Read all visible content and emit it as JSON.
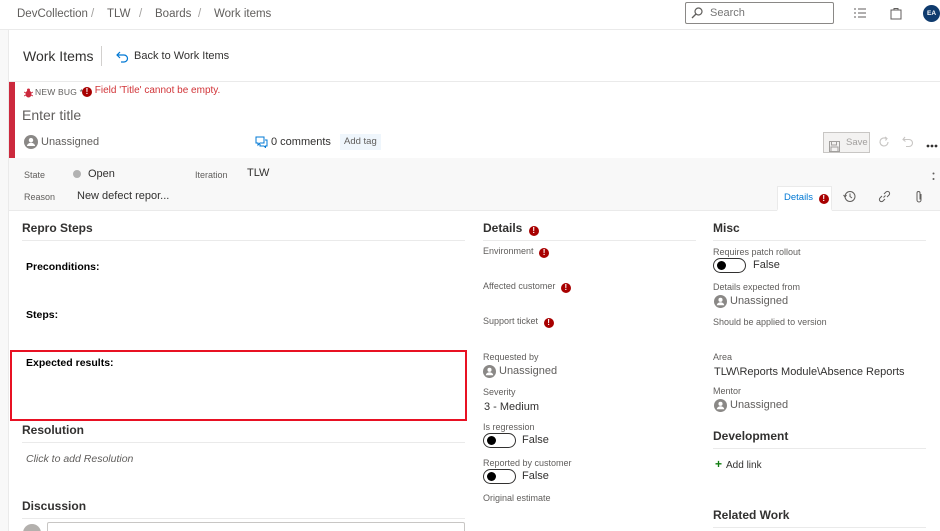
{
  "breadcrumb": {
    "org": "DevCollection",
    "project": "TLW",
    "hub": "Boards",
    "page": "Work items",
    "separator": "/"
  },
  "search": {
    "placeholder": "Search"
  },
  "user": {
    "initials": "EA"
  },
  "header": {
    "title": "Work Items",
    "back_label": "Back to Work Items"
  },
  "work_item": {
    "type_label": "NEW BUG *",
    "title_error": "Field 'Title' cannot be empty.",
    "title_placeholder": "Enter title",
    "assigned_to": "Unassigned",
    "comments": "0 comments",
    "add_tag": "Add tag",
    "save_label": "Save"
  },
  "state_fields": {
    "state_label": "State",
    "state_value": "Open",
    "iteration_label": "Iteration",
    "iteration_value": "TLW",
    "reason_label": "Reason",
    "reason_value": "New defect repor..."
  },
  "tabs": {
    "details": "Details"
  },
  "repro": {
    "title": "Repro Steps",
    "preconditions": "Preconditions:",
    "steps": "Steps:",
    "expected": "Expected results:"
  },
  "resolution": {
    "title": "Resolution",
    "placeholder": "Click to add Resolution"
  },
  "discussion": {
    "title": "Discussion"
  },
  "details": {
    "title": "Details",
    "environment": "Environment",
    "affected_customer": "Affected customer",
    "support_ticket": "Support ticket",
    "requested_by_label": "Requested by",
    "requested_by_value": "Unassigned",
    "severity_label": "Severity",
    "severity_value": "3 - Medium",
    "is_regression_label": "Is regression",
    "is_regression_value": "False",
    "reported_by_customer_label": "Reported by customer",
    "reported_by_customer_value": "False",
    "original_estimate_label": "Original estimate"
  },
  "misc": {
    "title": "Misc",
    "requires_patch_label": "Requires patch rollout",
    "requires_patch_value": "False",
    "details_expected_label": "Details expected from",
    "details_expected_value": "Unassigned",
    "applied_version_label": "Should be applied to version",
    "area_label": "Area",
    "area_value": "TLW\\Reports Module\\Absence Reports",
    "mentor_label": "Mentor",
    "mentor_value": "Unassigned"
  },
  "development": {
    "title": "Development",
    "add_link": "Add link"
  },
  "related_work": {
    "title": "Related Work"
  },
  "colors": {
    "accent": "#0078d4",
    "bug_red": "#cc293d",
    "error": "#a80000",
    "highlight_border": "#e81123",
    "add_green": "#107c10"
  },
  "icons": {
    "search": "search-icon",
    "back": "back-arrow-icon",
    "bug": "bug-icon",
    "error": "error-icon",
    "person": "person-icon",
    "comment": "comment-icon",
    "save": "save-icon",
    "refresh": "refresh-icon",
    "undo": "undo-icon",
    "more": "more-icon",
    "history": "history-icon",
    "link": "link-icon",
    "attachment": "paperclip-icon"
  }
}
